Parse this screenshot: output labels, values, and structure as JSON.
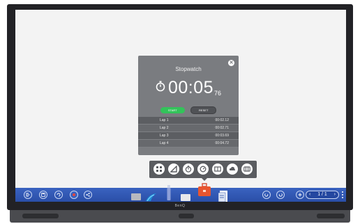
{
  "stopwatch": {
    "title": "Stopwatch",
    "time_main": "00:05",
    "time_ms": "76",
    "start_label": "START",
    "reset_label": "RESET",
    "laps": [
      {
        "name": "Lap 1",
        "time": "00:02.12"
      },
      {
        "name": "Lap 2",
        "time": "00:02.71"
      },
      {
        "name": "Lap 3",
        "time": "00:03.69"
      },
      {
        "name": "Lap 4",
        "time": "00:04.72"
      }
    ]
  },
  "tools": [
    "calculator-icon",
    "protractor-icon",
    "stopwatch-icon",
    "timer-icon",
    "spotlight-icon",
    "cloud-icon",
    "widget-icon"
  ],
  "taskbar": {
    "left_buttons": [
      "exit-icon",
      "save-icon",
      "rotate-icon",
      "record-icon",
      "share-icon"
    ],
    "page": "1 / 1"
  },
  "device": {
    "brand": "BenQ"
  },
  "colors": {
    "accent": "#3a63c0",
    "start": "#33c35a",
    "panel": "#7a7c80"
  }
}
